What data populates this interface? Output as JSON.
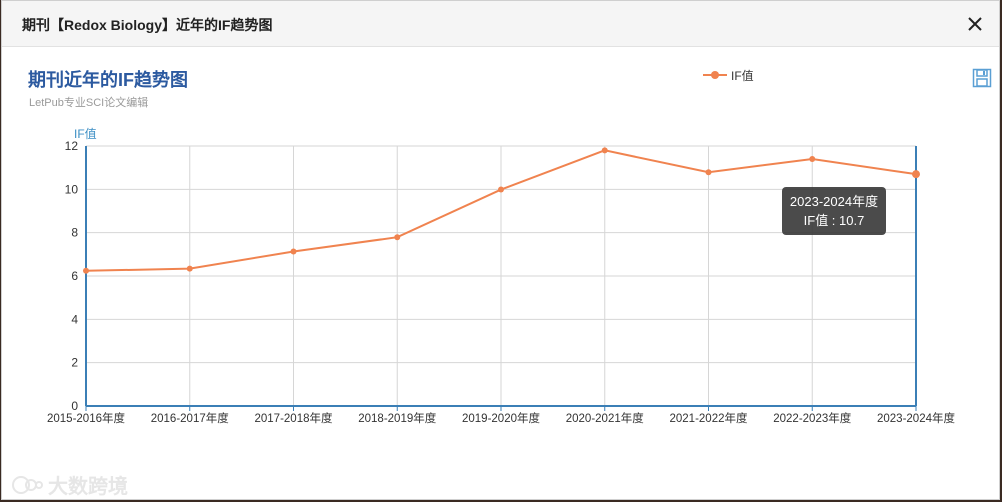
{
  "modal": {
    "title": "期刊【Redox Biology】近年的IF趋势图"
  },
  "chart_data": {
    "type": "line",
    "title": "期刊近年的IF趋势图",
    "subtitle": "LetPub专业SCI论文编辑",
    "ylabel": "IF值",
    "xlabel": "",
    "categories": [
      "2015-2016年度",
      "2016-2017年度",
      "2017-2018年度",
      "2018-2019年度",
      "2019-2020年度",
      "2020-2021年度",
      "2021-2022年度",
      "2022-2023年度",
      "2023-2024年度"
    ],
    "series": [
      {
        "name": "IF值",
        "values": [
          6.24,
          6.34,
          7.13,
          7.79,
          9.99,
          11.8,
          10.79,
          11.4,
          10.7
        ]
      }
    ],
    "ylim": [
      0,
      12
    ],
    "yticks": [
      0,
      2,
      4,
      6,
      8,
      10,
      12
    ],
    "grid": true,
    "legend_position": "top-center",
    "line_color": "#f0834f",
    "axis_color": "#3b7fb6"
  },
  "tooltip": {
    "title": "2023-2024年度",
    "label": "IF值 : 10.7"
  },
  "watermark": {
    "text": "大数跨境"
  },
  "icons": {
    "close": "close-icon",
    "save": "save-icon"
  }
}
